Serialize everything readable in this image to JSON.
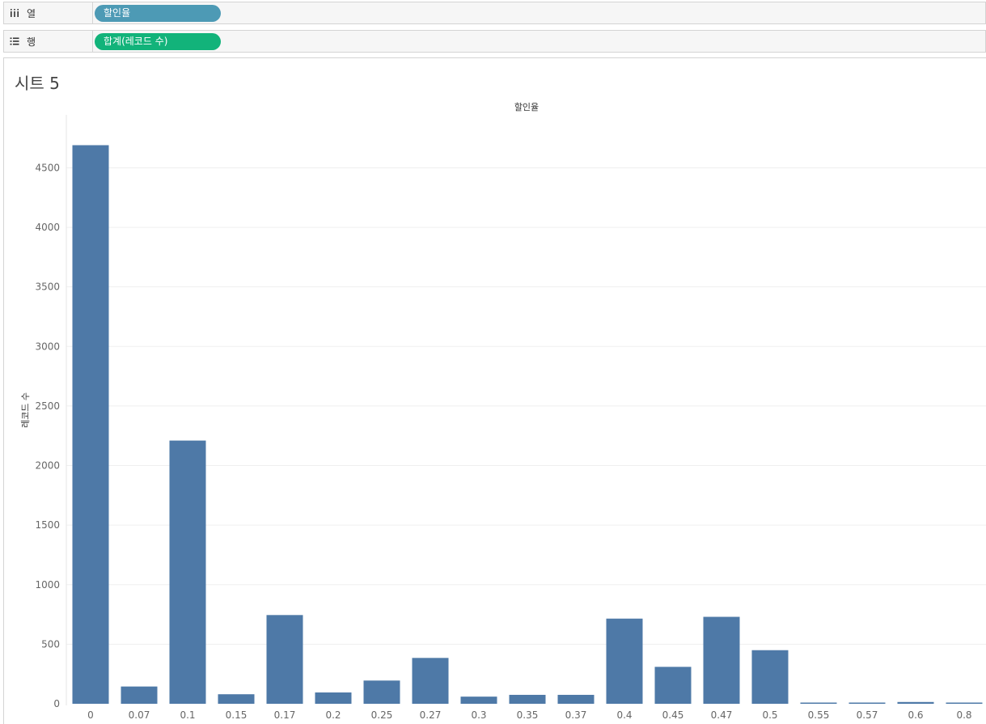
{
  "shelves": {
    "columns": {
      "label": "열",
      "icon": "columns-icon",
      "pill": "할인율"
    },
    "rows": {
      "label": "행",
      "icon": "rows-icon",
      "pill": "합계(레코드 수)"
    }
  },
  "sheet": {
    "title": "시트 5"
  },
  "colors": {
    "bar": "#4e79a7",
    "dimension_pill": "#4d9ab5",
    "measure_pill": "#12b37a",
    "grid": "#efefef"
  },
  "chart_data": {
    "type": "bar",
    "title": "할인율",
    "xlabel": "",
    "ylabel": "레코드 수",
    "ylim": [
      0,
      4700
    ],
    "yticks": [
      0,
      500,
      1000,
      1500,
      2000,
      2500,
      3000,
      3500,
      4000,
      4500
    ],
    "grid": true,
    "categories": [
      "0",
      "0.07",
      "0.1",
      "0.15",
      "0.17",
      "0.2",
      "0.25",
      "0.27",
      "0.3",
      "0.35",
      "0.37",
      "0.4",
      "0.45",
      "0.47",
      "0.5",
      "0.55",
      "0.57",
      "0.6",
      "0.8"
    ],
    "values": [
      4690,
      145,
      2210,
      80,
      745,
      95,
      195,
      385,
      60,
      75,
      75,
      715,
      310,
      730,
      450,
      4,
      10,
      15,
      10
    ]
  }
}
